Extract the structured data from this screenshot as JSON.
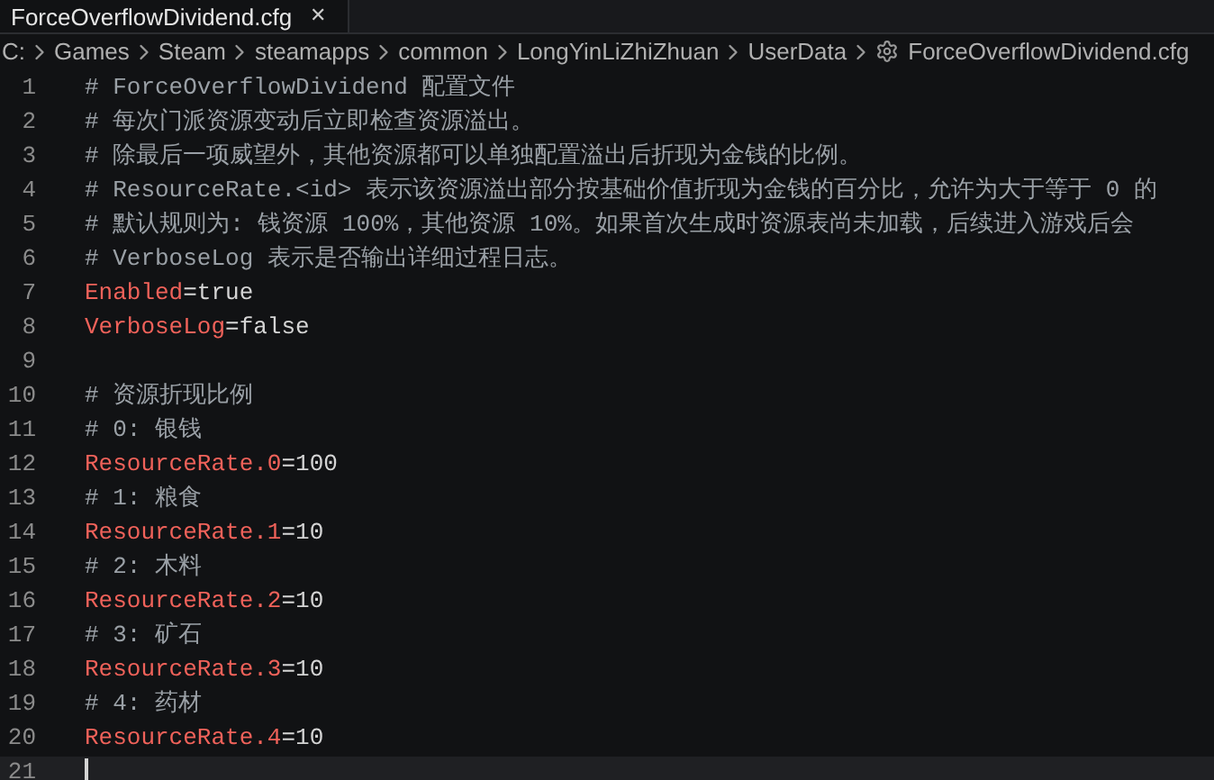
{
  "tab": {
    "title": "ForceOverflowDividend.cfg",
    "close": "✕"
  },
  "breadcrumb": [
    "C:",
    "Games",
    "Steam",
    "steamapps",
    "common",
    "LongYinLiZhiZhuan",
    "UserData",
    "ForceOverflowDividend.cfg"
  ],
  "lines": [
    {
      "number": "1",
      "kind": "comment",
      "text": "# ForceOverflowDividend 配置文件"
    },
    {
      "number": "2",
      "kind": "comment",
      "text": "# 每次门派资源变动后立即检查资源溢出。"
    },
    {
      "number": "3",
      "kind": "comment",
      "text": "# 除最后一项威望外，其他资源都可以单独配置溢出后折现为金钱的比例。"
    },
    {
      "number": "4",
      "kind": "comment",
      "text": "# ResourceRate.<id> 表示该资源溢出部分按基础价值折现为金钱的百分比，允许为大于等于 0 的"
    },
    {
      "number": "5",
      "kind": "comment",
      "text": "# 默认规则为: 钱资源 100%，其他资源 10%。如果首次生成时资源表尚未加载，后续进入游戏后会"
    },
    {
      "number": "6",
      "kind": "comment",
      "text": "# VerboseLog 表示是否输出详细过程日志。"
    },
    {
      "number": "7",
      "kind": "entry",
      "key": "Enabled",
      "sep": "=",
      "value": "true"
    },
    {
      "number": "8",
      "kind": "entry",
      "key": "VerboseLog",
      "sep": "=",
      "value": "false"
    },
    {
      "number": "9",
      "kind": "blank"
    },
    {
      "number": "10",
      "kind": "comment",
      "text": "# 资源折现比例"
    },
    {
      "number": "11",
      "kind": "comment",
      "text": "# 0: 银钱"
    },
    {
      "number": "12",
      "kind": "entry",
      "key": "ResourceRate.0",
      "sep": "=",
      "value": "100"
    },
    {
      "number": "13",
      "kind": "comment",
      "text": "# 1: 粮食"
    },
    {
      "number": "14",
      "kind": "entry",
      "key": "ResourceRate.1",
      "sep": "=",
      "value": "10"
    },
    {
      "number": "15",
      "kind": "comment",
      "text": "# 2: 木料"
    },
    {
      "number": "16",
      "kind": "entry",
      "key": "ResourceRate.2",
      "sep": "=",
      "value": "10"
    },
    {
      "number": "17",
      "kind": "comment",
      "text": "# 3: 矿石"
    },
    {
      "number": "18",
      "kind": "entry",
      "key": "ResourceRate.3",
      "sep": "=",
      "value": "10"
    },
    {
      "number": "19",
      "kind": "comment",
      "text": "# 4: 药材"
    },
    {
      "number": "20",
      "kind": "entry",
      "key": "ResourceRate.4",
      "sep": "=",
      "value": "10"
    },
    {
      "number": "21",
      "kind": "blank",
      "current": true
    }
  ]
}
